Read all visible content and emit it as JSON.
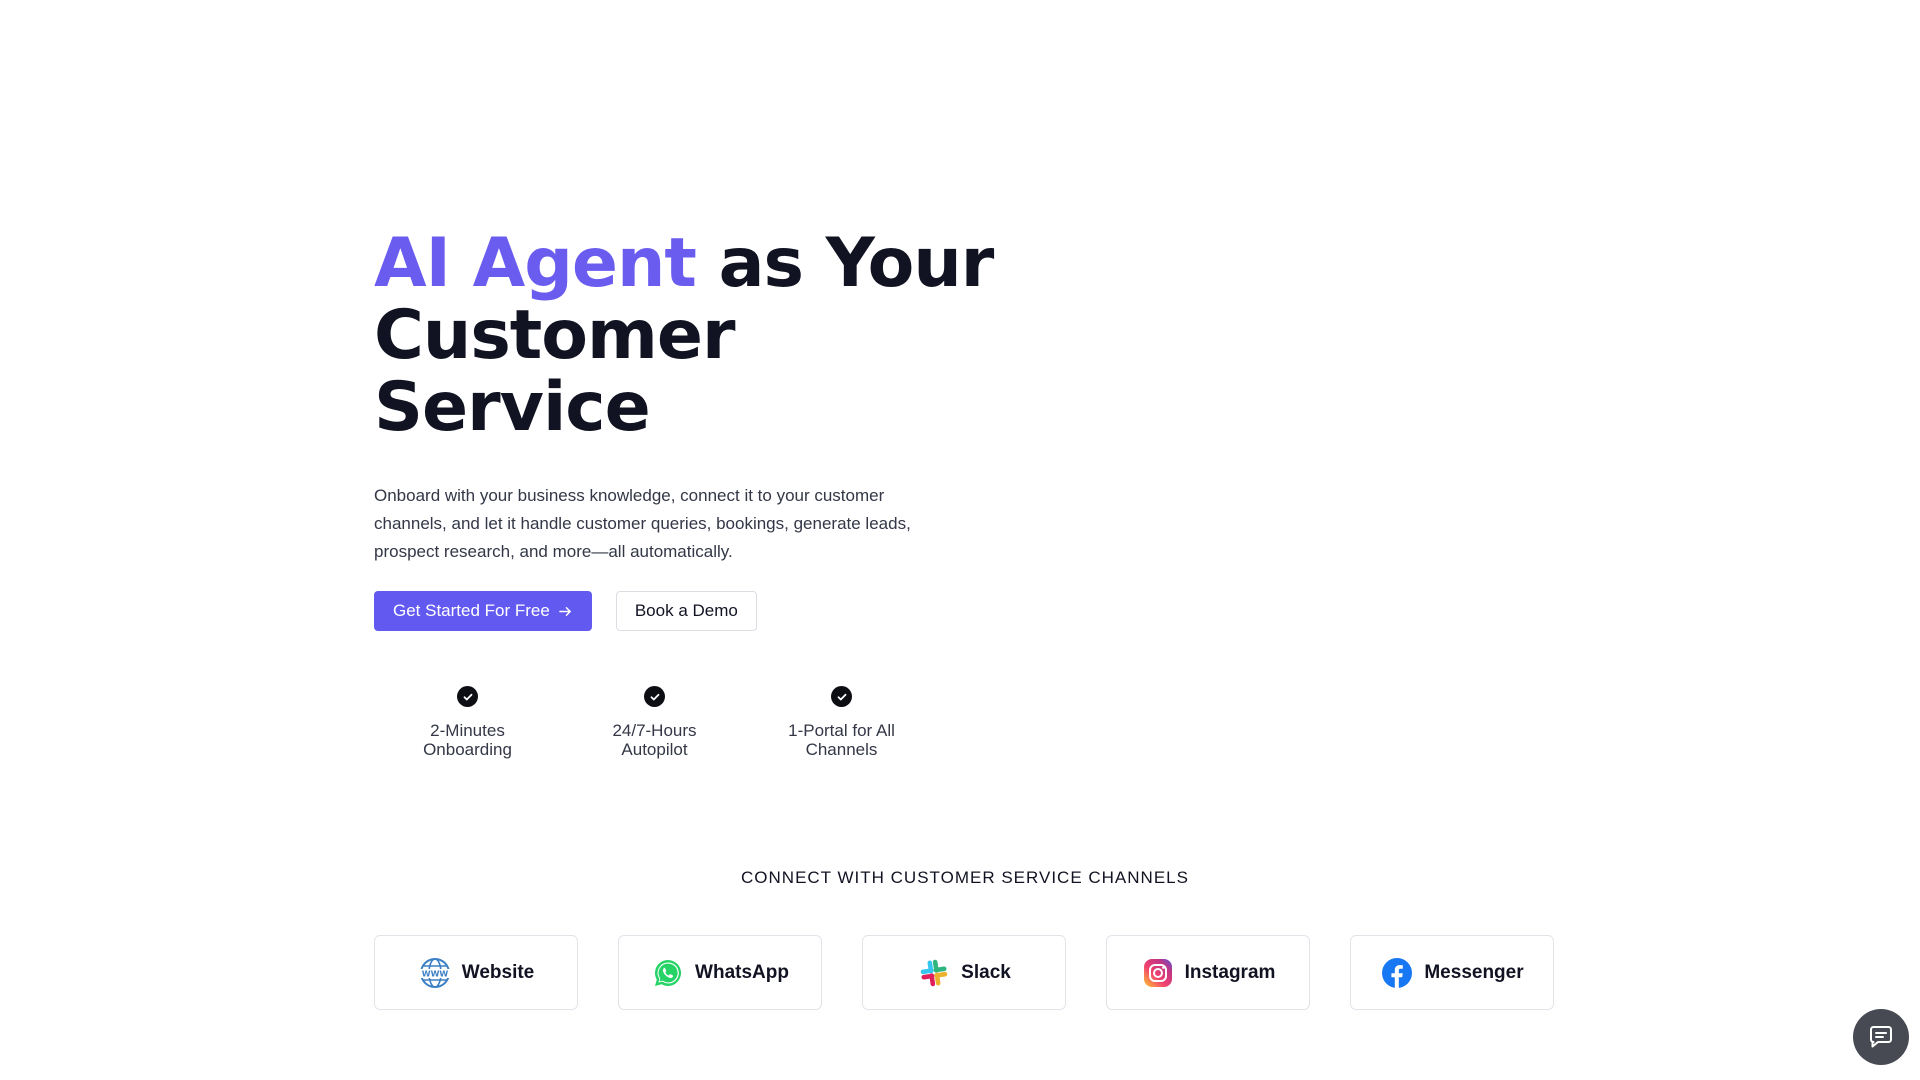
{
  "hero": {
    "headline_accent": "AI Agent",
    "headline_rest": " as Your",
    "headline_line2": "Customer",
    "headline_line3": "Service",
    "subtitle": "Onboard with your business knowledge, connect it to your customer channels, and let it handle customer queries, bookings, generate leads, prospect research, and more—all automatically.",
    "primary_cta": "Get Started For Free",
    "secondary_cta": "Book a Demo",
    "accent_color": "#6b5cf0"
  },
  "features": [
    {
      "line1": "2-Minutes",
      "line2": "Onboarding",
      "icon": "check-circle-icon"
    },
    {
      "line1": "24/7-Hours",
      "line2": "Autopilot",
      "icon": "check-circle-icon"
    },
    {
      "line1": "1-Portal for All",
      "line2": "Channels",
      "icon": "check-circle-icon"
    }
  ],
  "channels_title": "CONNECT WITH CUSTOMER SERVICE CHANNELS",
  "channels": [
    {
      "label": "Website",
      "icon": "globe-www-icon"
    },
    {
      "label": "WhatsApp",
      "icon": "whatsapp-icon"
    },
    {
      "label": "Slack",
      "icon": "slack-icon"
    },
    {
      "label": "Instagram",
      "icon": "instagram-icon"
    },
    {
      "label": "Messenger",
      "icon": "messenger-icon"
    }
  ],
  "chat_widget": {
    "icon": "chat-bubble-icon"
  }
}
